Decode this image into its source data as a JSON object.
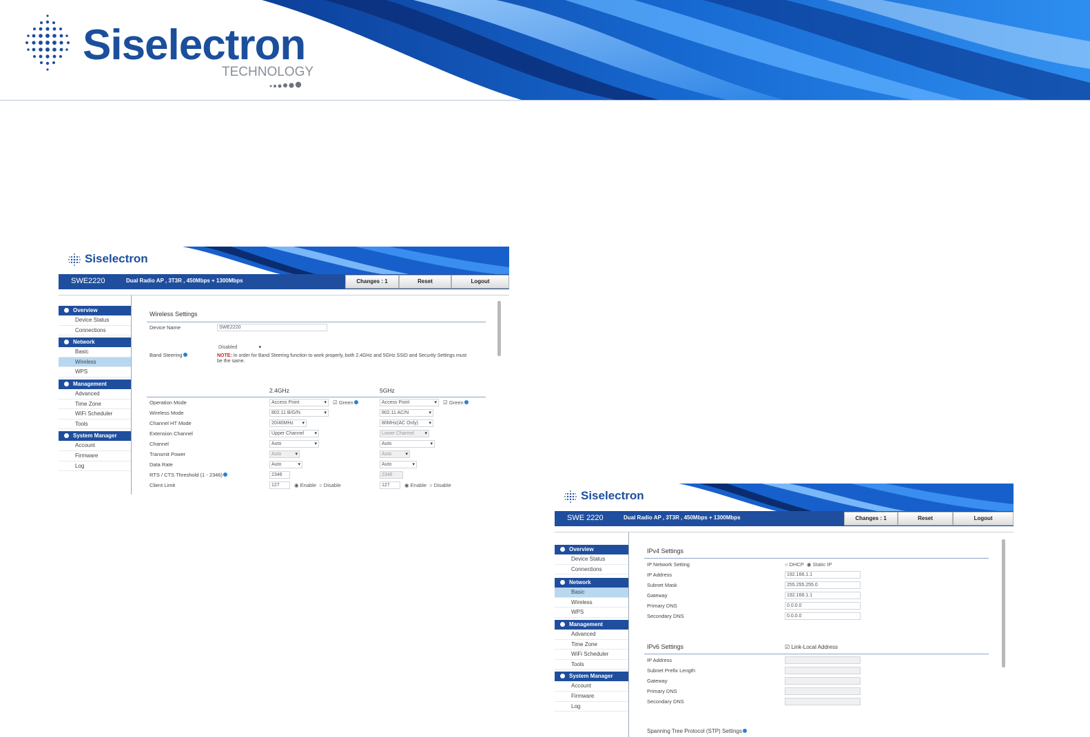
{
  "banner": {
    "brand": "Siselectron",
    "subtitle": "TECHNOLOGY",
    "colors": {
      "brand_blue": "#1b4f9c",
      "wave_blue": "#1c6fd6"
    }
  },
  "panel_wireless": {
    "logo": "Siselectron",
    "model": "SWE2220",
    "description": "Dual Radio AP , 3T3R , 450Mbps + 1300Mbps",
    "buttons": {
      "changes": "Changes : 1",
      "reset": "Reset",
      "logout": "Logout"
    },
    "sidebar": [
      {
        "section": "Overview",
        "items": [
          "Device Status",
          "Connections"
        ]
      },
      {
        "section": "Network",
        "items": [
          "Basic",
          "Wireless",
          "WPS"
        ]
      },
      {
        "section": "Management",
        "items": [
          "Advanced",
          "Time Zone",
          "WiFi Scheduler",
          "Tools"
        ]
      },
      {
        "section": "System Manager",
        "items": [
          "Account",
          "Firmware",
          "Log"
        ]
      }
    ],
    "active_item": "Wireless",
    "form": {
      "title": "Wireless Settings",
      "device_name_label": "Device Name",
      "device_name_value": "SWE2220",
      "band_steering_label": "Band Steering",
      "band_steering_value": "Disabled",
      "note_label": "NOTE:",
      "note_text": "In order for Band Steering function to work properly, both 2.4GHz and 5GHz SSID and Security Settings must be the same.",
      "col_24": "2.4GHz",
      "col_5": "5GHz",
      "rows": [
        {
          "label": "Operation Mode",
          "v24": "Access Point",
          "v5": "Access Point",
          "extra": "Green"
        },
        {
          "label": "Wireless Mode",
          "v24": "802.11 B/G/N",
          "v5": "802.11 AC/N"
        },
        {
          "label": "Channel HT Mode",
          "v24": "20/40MHz",
          "v5": "80MHz(AC Only)"
        },
        {
          "label": "Extension Channel",
          "v24": "Upper Channel",
          "v5": "Lower Channel"
        },
        {
          "label": "Channel",
          "v24": "Auto",
          "v5": "Auto"
        },
        {
          "label": "Transmit Power",
          "v24": "Auto",
          "v5": "Auto"
        },
        {
          "label": "Data Rate",
          "v24": "Auto",
          "v5": "Auto"
        },
        {
          "label": "RTS / CTS Threshold (1 - 2346)",
          "v24": "2346",
          "v5": "2346"
        },
        {
          "label": "Client Limit",
          "v24": "127",
          "v5": "127",
          "enable": "Enable",
          "disable": "Disable"
        }
      ]
    }
  },
  "panel_basic": {
    "logo": "Siselectron",
    "model": "SWE 2220",
    "description": "Dual Radio AP , 3T3R , 450Mbps + 1300Mbps",
    "buttons": {
      "changes": "Changes : 1",
      "reset": "Reset",
      "logout": "Logout"
    },
    "sidebar": [
      {
        "section": "Overview",
        "items": [
          "Device Status",
          "Connections"
        ]
      },
      {
        "section": "Network",
        "items": [
          "Basic",
          "Wireless",
          "WPS"
        ]
      },
      {
        "section": "Management",
        "items": [
          "Advanced",
          "Time Zone",
          "WiFi Scheduler",
          "Tools"
        ]
      },
      {
        "section": "System Manager",
        "items": [
          "Account",
          "Firmware",
          "Log"
        ]
      }
    ],
    "active_item": "Basic",
    "ipv4": {
      "title": "IPv4 Settings",
      "network_setting_label": "IP Network Setting",
      "dhcp": "DHCP",
      "static_ip": "Static IP",
      "rows": [
        {
          "label": "IP Address",
          "value": "192.168.1.1"
        },
        {
          "label": "Subnet Mask",
          "value": "255.255.255.0"
        },
        {
          "label": "Gateway",
          "value": "192.168.1.1"
        },
        {
          "label": "Primary DNS",
          "value": "0.0.0.0"
        },
        {
          "label": "Secondary DNS",
          "value": "0.0.0.0"
        }
      ]
    },
    "ipv6": {
      "title": "IPv6 Settings",
      "link_local": "Link-Local Address",
      "rows": [
        "IP Address",
        "Subnet Prefix Length",
        "Gateway",
        "Primary DNS",
        "Secondary DNS"
      ]
    },
    "footer_section": "Spanning Tree Protocol (STP) Settings"
  }
}
